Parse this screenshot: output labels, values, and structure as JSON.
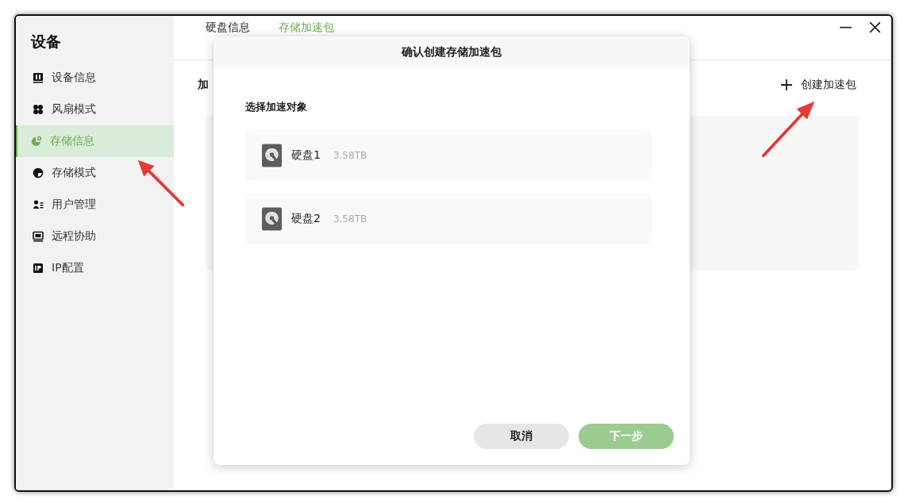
{
  "sidebar": {
    "title": "设备",
    "items": [
      {
        "label": "设备信息",
        "selected": false
      },
      {
        "label": "风扇模式",
        "selected": false
      },
      {
        "label": "存储信息",
        "selected": true
      },
      {
        "label": "存储模式",
        "selected": false
      },
      {
        "label": "用户管理",
        "selected": false
      },
      {
        "label": "远程协助",
        "selected": false
      },
      {
        "label": "IP配置",
        "selected": false
      }
    ]
  },
  "tabs": [
    {
      "label": "硬盘信息",
      "selected": false
    },
    {
      "label": "存储加速包",
      "selected": true
    }
  ],
  "content": {
    "heading": "加",
    "create_button": "创建加速包"
  },
  "dialog": {
    "title": "确认创建存储加速包",
    "prompt": "选择加速对象",
    "disks": [
      {
        "name": "硬盘1",
        "size": "3.58TB",
        "selected": false
      },
      {
        "name": "硬盘2",
        "size": "3.58TB",
        "selected": false
      }
    ],
    "buttons": [
      {
        "label": "取消",
        "kind": "cancel",
        "disabled": false
      },
      {
        "label": "下一步",
        "kind": "next",
        "disabled": true
      }
    ]
  }
}
